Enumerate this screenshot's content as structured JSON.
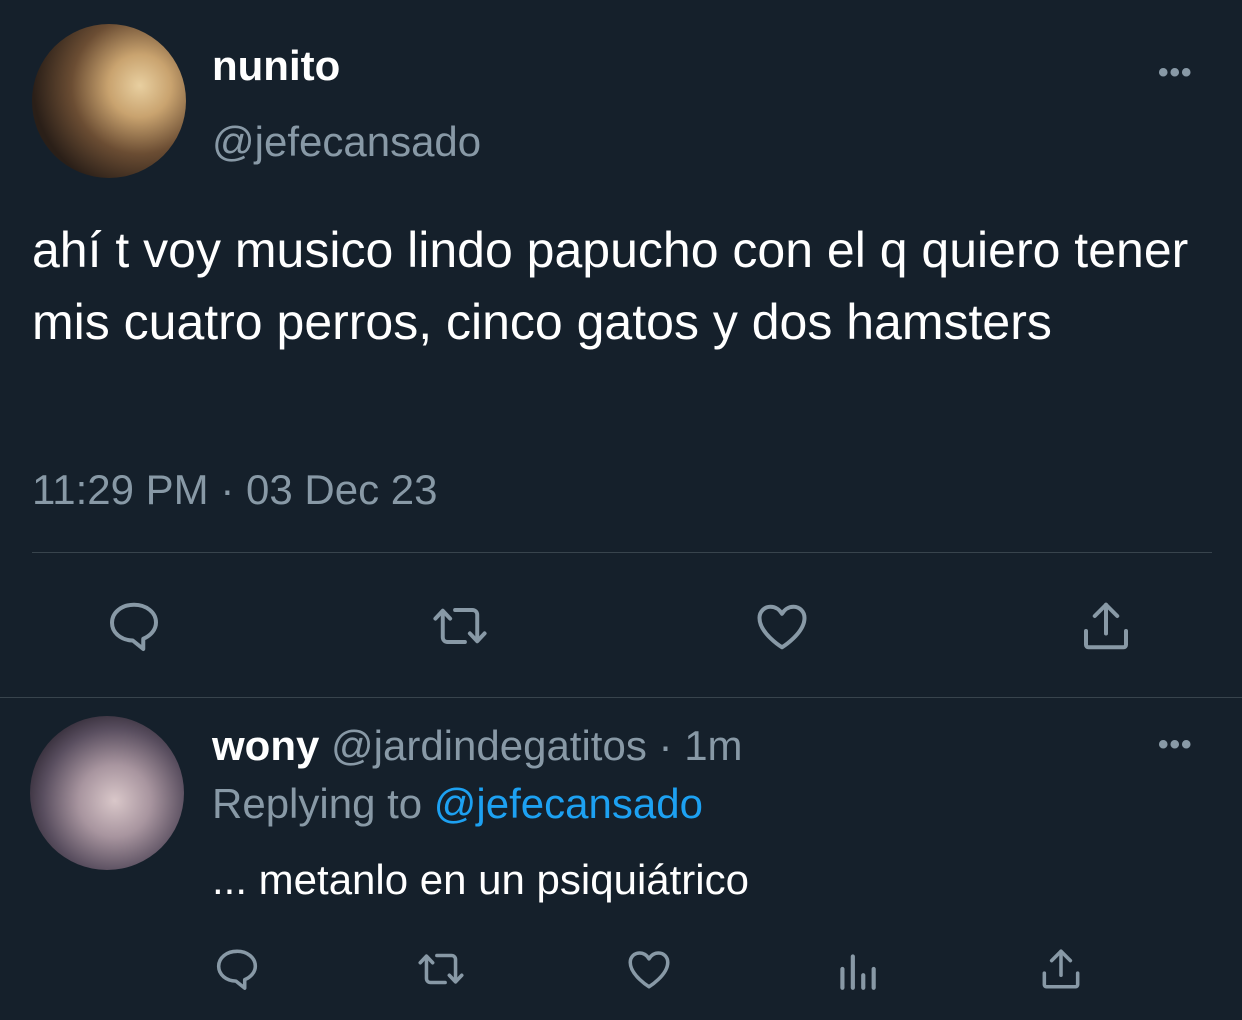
{
  "main_tweet": {
    "display_name": "nunito",
    "handle": "@jefecansado",
    "text": "ahí t voy musico lindo papucho con el q quiero tener mis cuatro perros, cinco gatos y dos hamsters",
    "time": "11:29 PM",
    "separator": "·",
    "date": "03 Dec 23",
    "more_label": "•••",
    "actions": [
      "reply-icon",
      "retweet-icon",
      "like-icon",
      "share-icon"
    ]
  },
  "reply_tweet": {
    "display_name": "wony",
    "handle": "@jardindegatitos",
    "separator": "·",
    "age": "1m",
    "replying_to_label": "Replying to",
    "replying_to_handle": "@jefecansado",
    "text": "... metanlo en un psiquiátrico",
    "more_label": "•••",
    "actions": [
      "reply-icon",
      "retweet-icon",
      "like-icon",
      "analytics-icon",
      "share-icon"
    ]
  },
  "colors": {
    "background": "#15202b",
    "text": "#ffffff",
    "muted": "#8899a6",
    "link": "#1da1f2",
    "divider": "#38444d"
  }
}
